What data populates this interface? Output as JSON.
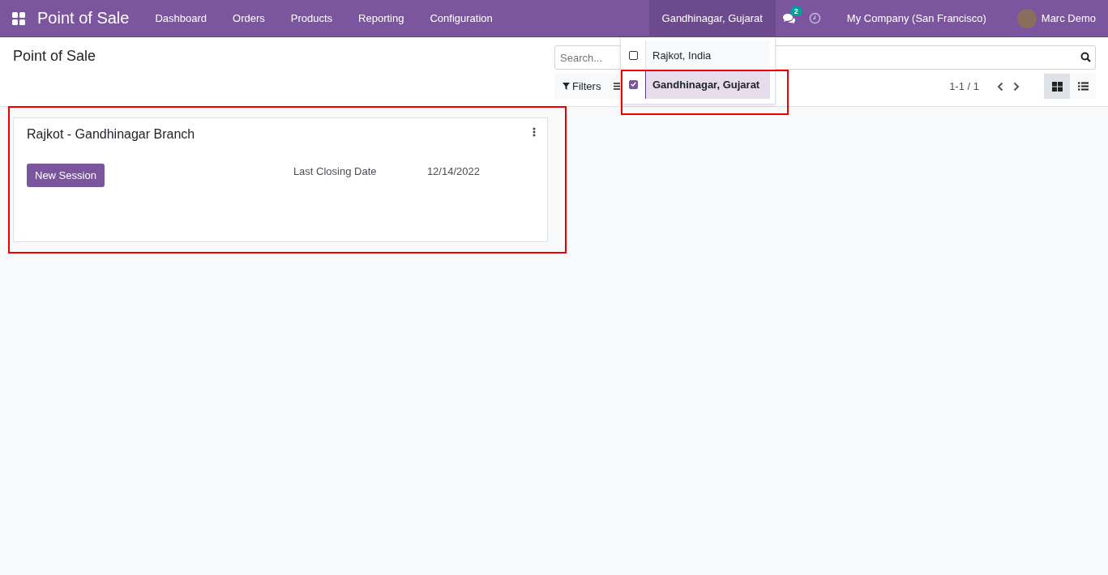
{
  "navbar": {
    "app_title": "Point of Sale",
    "menu": [
      "Dashboard",
      "Orders",
      "Products",
      "Reporting",
      "Configuration"
    ],
    "branch_switcher": "Gandhinagar, Gujarat",
    "messages_badge": "2",
    "company": "My Company (San Francisco)",
    "user": "Marc Demo"
  },
  "branch_dropdown": [
    {
      "label": "Rajkot, India",
      "checked": false
    },
    {
      "label": "Gandhinagar, Gujarat",
      "checked": true
    }
  ],
  "control_panel": {
    "title": "Point of Sale",
    "search": {
      "placeholder": "Search..."
    },
    "filters": "Filters",
    "pager": "1-1 / 1",
    "views": [
      {
        "kind": "kanban",
        "selected": true
      },
      {
        "kind": "list",
        "selected": false
      }
    ]
  },
  "cards": [
    {
      "title": "Rajkot - Gandhinagar Branch",
      "button": "New Session",
      "label": "Last Closing Date",
      "value": "12/14/2022"
    }
  ]
}
